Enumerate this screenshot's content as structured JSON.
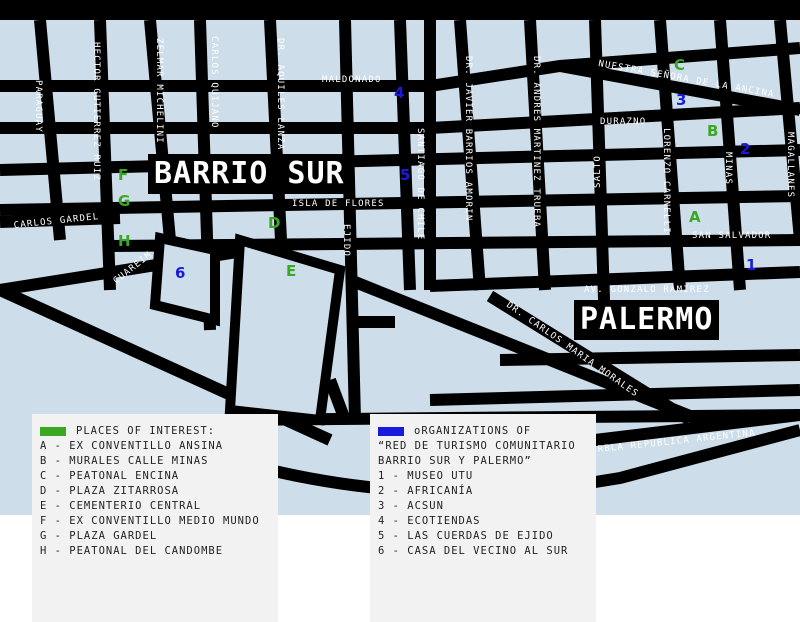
{
  "colors": {
    "water": "#cddde9",
    "land": "#ffffff",
    "streets": "#000000",
    "places_marker": "#3aa823",
    "organizations_marker": "#1a1adc"
  },
  "neighborhoods": [
    "BARRIO SUR",
    "PALERMO"
  ],
  "streets": {
    "paraguay": "PARAGUAY",
    "hector_gutierrez_ruiz": "HECTOR GUTIERREZ RUIZ",
    "zelmar_michelini": "ZELMAR MICHELINI",
    "carlos_quijano": "CARLOS QUIJANO",
    "dr_aquiles_lanza": "DR. AQUILES LANZA",
    "maldonado": "MALDONADO",
    "dr_javier_barrios_amorin": "DR. JAVIER BARRIOS AMORIN",
    "dr_andres_martinez_trueba": "DR. ANDRES MARTINEZ TRUEBA",
    "nuestra_senora": "NUESTRA SEÑORA DE LA ANCINA",
    "durazno": "DURAZNO",
    "salto": "SALTO",
    "lorenzo_carnelli": "LORENZO CARNELLI",
    "minas": "MINAS",
    "magallanes": "MAGALLANES",
    "santiago_de_chile": "SANTIAGO DE CHILE",
    "isla_de_flores": "ISLA DE FLORES",
    "carlos_gardel": "CARLOS GARDEL",
    "cuareim": "CUAREIM",
    "ejido": "EJIDO",
    "san_salvador": "SAN SALVADOR",
    "av_gonzalo_ramirez": "AV. GONZALO RAMIREZ",
    "dr_carlos_maria_morales": "DR. CARLOS MARIA MORALES",
    "rbla_republica_argentina": "RBLA REPUBLICA ARGENTINA"
  },
  "markers": {
    "places": [
      "A",
      "B",
      "C",
      "D",
      "E",
      "F",
      "G",
      "H"
    ],
    "organizations": [
      "1",
      "2",
      "3",
      "4",
      "5",
      "6"
    ]
  },
  "legend_places": {
    "title": "PLACES OF INTEREST:",
    "items": [
      "A - EX CONVENTILLO ANSINA",
      "B - MURALES CALLE MINAS",
      "C - PEATONAL ENCINA",
      "D - PLAZA ZITARROSA",
      "E - CEMENTERIO CENTRAL",
      "F - EX CONVENTILLO MEDIO MUNDO",
      "G - PLAZA GARDEL",
      "H - PEATONAL DEL CANDOMBE"
    ]
  },
  "legend_organizations": {
    "title": "oRGANIZATIONS OF",
    "subtitle_1": "“RED DE TURISMO COMUNITARIO",
    "subtitle_2": "BARRIO SUR Y PALERMO”",
    "items": [
      "1 - MUSEO UTU",
      "2 - AFRICANÍA",
      "3 - ACSUN",
      "4 - ECOTIENDAS",
      "5 - LAS CUERDAS DE EJIDO",
      "6 - CASA DEL VECINO AL SUR"
    ]
  }
}
